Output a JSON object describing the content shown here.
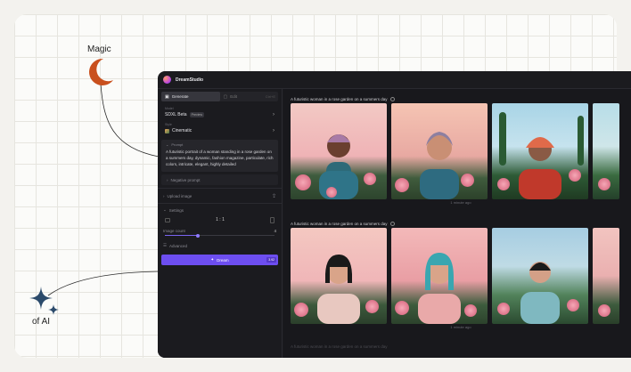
{
  "annotations": {
    "magic": "Magic",
    "of_ai": "of AI"
  },
  "app": {
    "brand": "DreamStudio",
    "tabs": [
      {
        "label": "Generate"
      },
      {
        "label": "Edit",
        "shortcut": "Ctrl+E"
      }
    ],
    "model": {
      "label": "Model",
      "value": "SDXL Beta",
      "badge": "Preview"
    },
    "style": {
      "label": "Style",
      "value": "Cinematic"
    },
    "prompt": {
      "label": "Prompt",
      "text": "A futuristic portrait of a woman standing in a rose garden on a summers day, dynamic, fashion magazine, particulate, rich colors, intricate, elegant, highly detailed"
    },
    "negative_prompt": "Negative prompt",
    "upload_image": "Upload image",
    "settings": "Settings",
    "aspect_ratio": "1 : 1",
    "image_count": {
      "label": "Image count",
      "value": "4",
      "fraction": 0.3
    },
    "advanced": "Advanced",
    "dream_button": {
      "label": "Dream",
      "cost": "3.92"
    }
  },
  "results": [
    {
      "prompt": "A futuristic woman in a rose garden on a summers day",
      "time": "1 minute ago"
    },
    {
      "prompt": "A futuristic woman in a rose garden on a summers day",
      "time": "1 minute ago"
    },
    {
      "prompt": "A futuristic woman in a rose garden on a summers day"
    }
  ],
  "colors": {
    "accent": "#6d4ef0",
    "moon": "#c9501e",
    "sparkle": "#2b4a6b"
  }
}
